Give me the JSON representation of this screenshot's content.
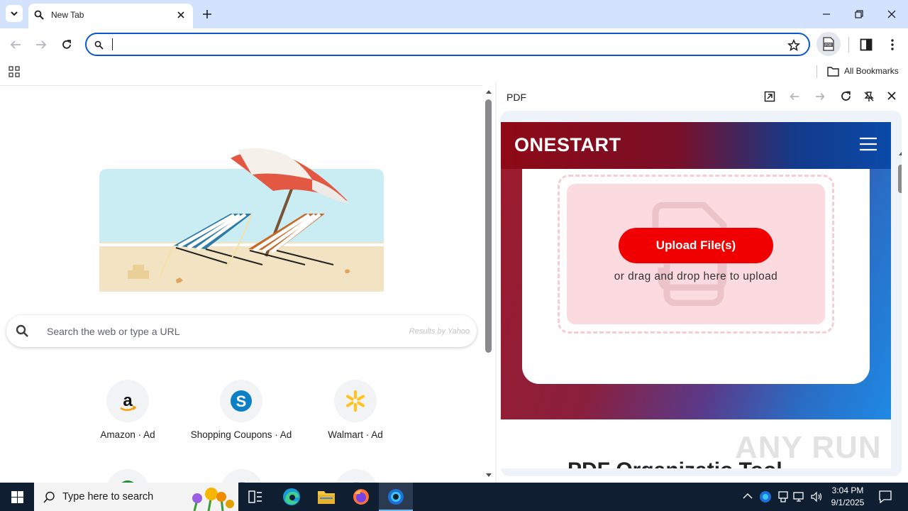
{
  "browser": {
    "tab_title": "New Tab",
    "omnibox_value": "",
    "bookmarks_label": "All Bookmarks",
    "accent": "#0b57d0"
  },
  "newtab": {
    "search_placeholder": "Search the web or type a URL",
    "search_provider": "Results by Yahoo",
    "tiles": [
      {
        "label": "Amazon · Ad",
        "icon": "amazon-icon"
      },
      {
        "label": "Shopping Coupons · Ad",
        "icon": "shopping-coupons-icon"
      },
      {
        "label": "Walmart · Ad",
        "icon": "walmart-icon"
      }
    ]
  },
  "side_panel": {
    "title": "PDF",
    "site": {
      "logo": "ONESTART",
      "upload_button": "Upload File(s)",
      "drop_text": "or drag and drop here to upload",
      "heading_partial": "PDF Organizatio Tool",
      "brand_red": "#f00000"
    }
  },
  "watermark": "ANY RUN",
  "taskbar": {
    "search_placeholder": "Type here to search",
    "time": "3:04 PM",
    "date": "9/1/2025"
  }
}
